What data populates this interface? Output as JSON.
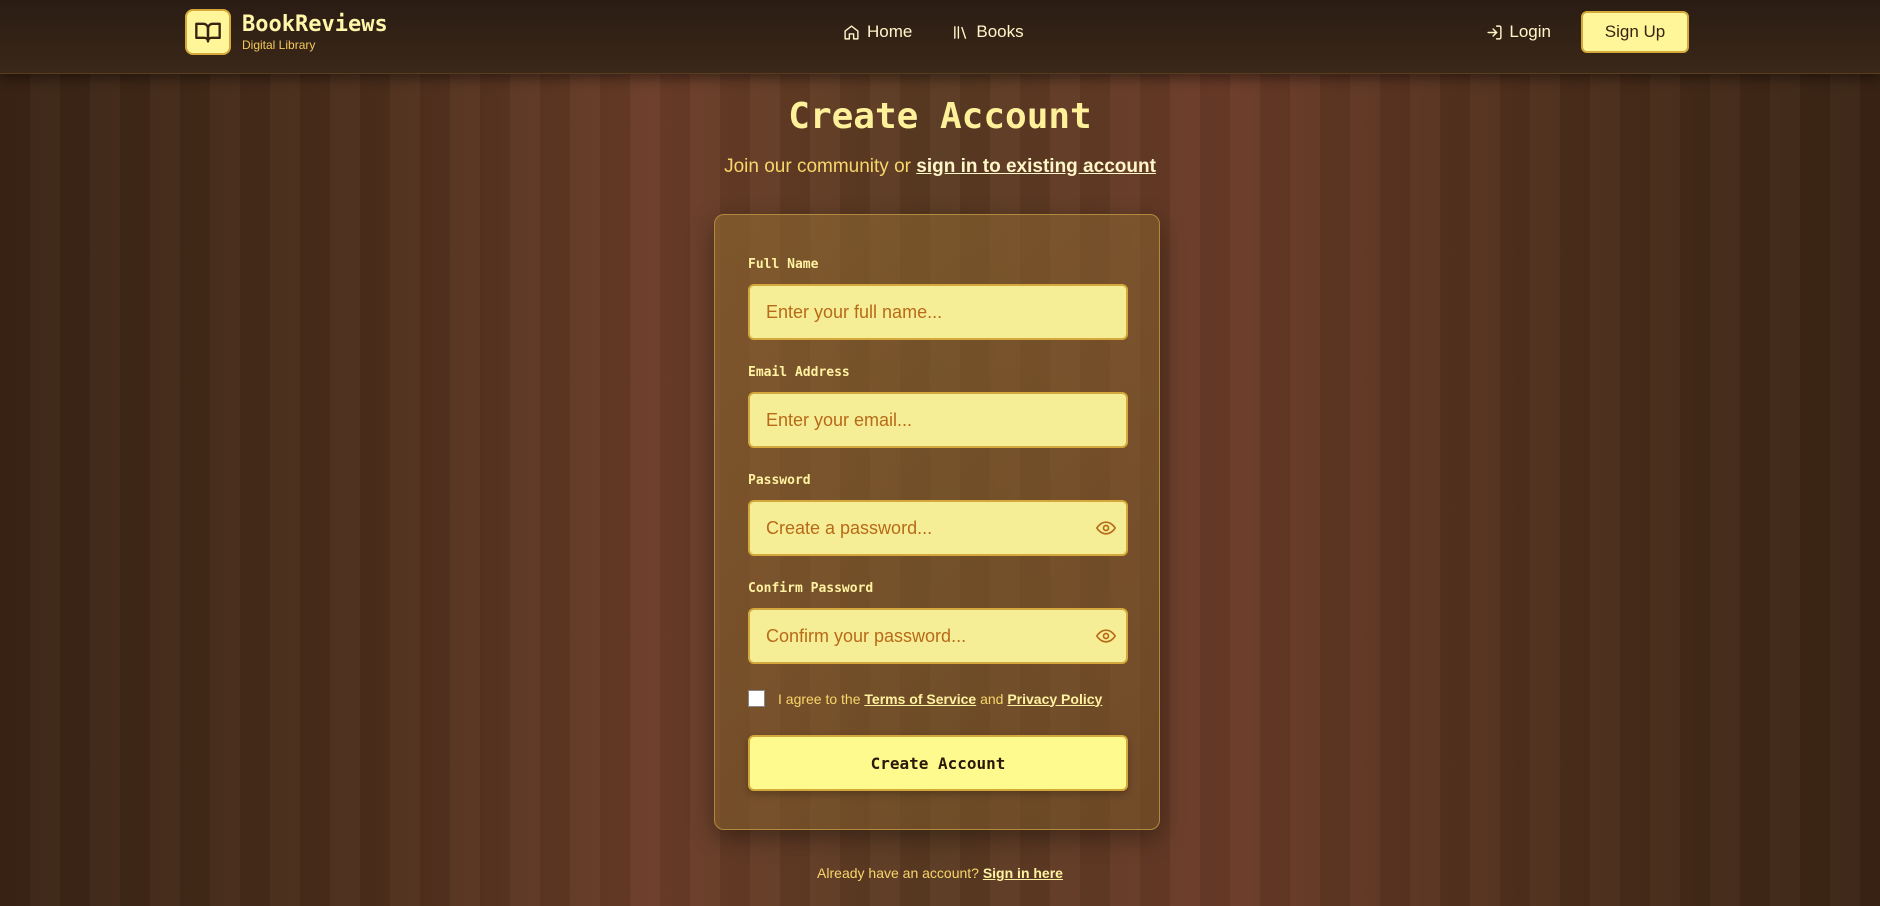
{
  "nav": {
    "brand_title": "BookReviews",
    "brand_subtitle": "Digital Library",
    "home_label": "Home",
    "books_label": "Books",
    "login_label": "Login",
    "signup_label": "Sign Up"
  },
  "header": {
    "title": "Create Account",
    "subtitle_prefix": "Join our community or ",
    "subtitle_link": "sign in to existing account"
  },
  "form": {
    "full_name_label": "Full Name",
    "full_name_placeholder": "Enter your full name...",
    "email_label": "Email Address",
    "email_placeholder": "Enter your email...",
    "password_label": "Password",
    "password_placeholder": "Create a password...",
    "confirm_label": "Confirm Password",
    "confirm_placeholder": "Confirm your password...",
    "terms_prefix": "I agree to the ",
    "terms_link": "Terms of Service",
    "terms_and": " and ",
    "privacy_link": "Privacy Policy",
    "submit_label": "Create Account"
  },
  "footer": {
    "prefix": "Already have an account? ",
    "link": "Sign in here"
  },
  "colors": {
    "accent": "#fff69a",
    "accent_border": "#d4a83a",
    "text_gold": "#f8d66a"
  }
}
